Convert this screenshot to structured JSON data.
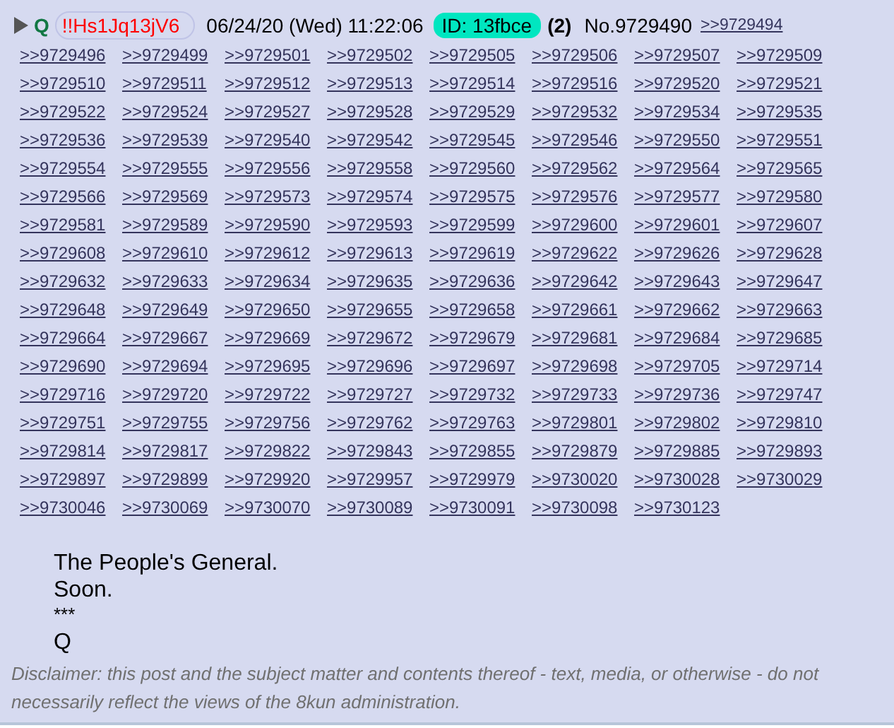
{
  "post": {
    "name": "Q",
    "tripcode": "!!Hs1Jq13jV6",
    "date": "06/24/20 (Wed) 11:22:06",
    "id_label": "ID: 13fbce",
    "post_count": "(2)",
    "number": "No.9729490",
    "replies": [
      ">>9729494",
      ">>9729496",
      ">>9729499",
      ">>9729501",
      ">>9729502",
      ">>9729505",
      ">>9729506",
      ">>9729507",
      ">>9729509",
      ">>9729510",
      ">>9729511",
      ">>9729512",
      ">>9729513",
      ">>9729514",
      ">>9729516",
      ">>9729520",
      ">>9729521",
      ">>9729522",
      ">>9729524",
      ">>9729527",
      ">>9729528",
      ">>9729529",
      ">>9729532",
      ">>9729534",
      ">>9729535",
      ">>9729536",
      ">>9729539",
      ">>9729540",
      ">>9729542",
      ">>9729545",
      ">>9729546",
      ">>9729550",
      ">>9729551",
      ">>9729554",
      ">>9729555",
      ">>9729556",
      ">>9729558",
      ">>9729560",
      ">>9729562",
      ">>9729564",
      ">>9729565",
      ">>9729566",
      ">>9729569",
      ">>9729573",
      ">>9729574",
      ">>9729575",
      ">>9729576",
      ">>9729577",
      ">>9729580",
      ">>9729581",
      ">>9729589",
      ">>9729590",
      ">>9729593",
      ">>9729599",
      ">>9729600",
      ">>9729601",
      ">>9729607",
      ">>9729608",
      ">>9729610",
      ">>9729612",
      ">>9729613",
      ">>9729619",
      ">>9729622",
      ">>9729626",
      ">>9729628",
      ">>9729632",
      ">>9729633",
      ">>9729634",
      ">>9729635",
      ">>9729636",
      ">>9729642",
      ">>9729643",
      ">>9729647",
      ">>9729648",
      ">>9729649",
      ">>9729650",
      ">>9729655",
      ">>9729658",
      ">>9729661",
      ">>9729662",
      ">>9729663",
      ">>9729664",
      ">>9729667",
      ">>9729669",
      ">>9729672",
      ">>9729679",
      ">>9729681",
      ">>9729684",
      ">>9729685",
      ">>9729690",
      ">>9729694",
      ">>9729695",
      ">>9729696",
      ">>9729697",
      ">>9729698",
      ">>9729705",
      ">>9729714",
      ">>9729716",
      ">>9729720",
      ">>9729722",
      ">>9729727",
      ">>9729732",
      ">>9729733",
      ">>9729736",
      ">>9729747",
      ">>9729751",
      ">>9729755",
      ">>9729756",
      ">>9729762",
      ">>9729763",
      ">>9729801",
      ">>9729802",
      ">>9729810",
      ">>9729814",
      ">>9729817",
      ">>9729822",
      ">>9729843",
      ">>9729855",
      ">>9729879",
      ">>9729885",
      ">>9729893",
      ">>9729897",
      ">>9729899",
      ">>9729920",
      ">>9729957",
      ">>9729979",
      ">>9730020",
      ">>9730028",
      ">>9730029",
      ">>9730046",
      ">>9730069",
      ">>9730070",
      ">>9730089",
      ">>9730091",
      ">>9730098",
      ">>9730123"
    ],
    "body": [
      "The People's General.",
      "Soon.",
      "***",
      "Q"
    ],
    "disclaimer": "Disclaimer: this post and the subject matter and contents thereof - text, media, or otherwise - do not necessarily reflect the views of the 8kun administration."
  }
}
